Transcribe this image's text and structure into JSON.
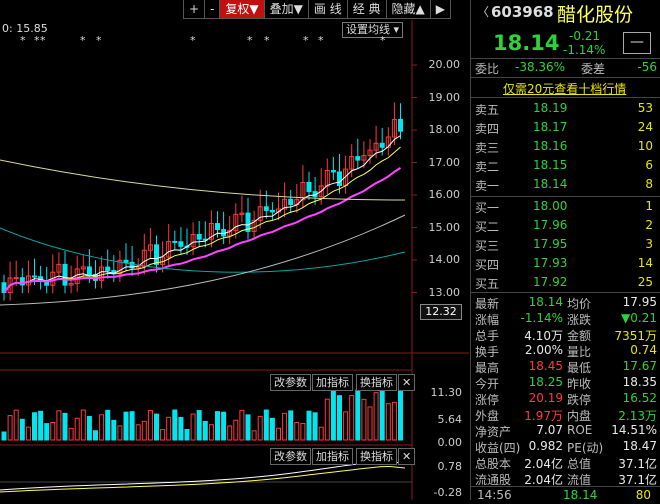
{
  "toolbar": {
    "plus": "+",
    "minus": "-",
    "fuquan": "复权▼",
    "diejia": "叠加▼",
    "huaxian": "画 线",
    "jingdian": "经 典",
    "yincang": "隐藏▲",
    "scroll": "▶"
  },
  "chart": {
    "info_text": "0: 15.85",
    "set_ma": "设置均线",
    "price_ticks": [
      "20.00",
      "19.00",
      "18.00",
      "17.00",
      "16.00",
      "15.00",
      "14.00",
      "13.00"
    ],
    "current_label": "12.32",
    "vol_ticks": [
      "11.30",
      "5.64",
      "0.00"
    ],
    "macd_ticks": [
      "0.78",
      "-0.28"
    ],
    "vol_buttons": [
      "改参数",
      "加指标",
      "换指标"
    ],
    "macd_buttons": [
      "改参数",
      "加指标",
      "换指标"
    ],
    "close": "✕"
  },
  "quote": {
    "code": "603968",
    "name": "醋化股份",
    "price": "18.14",
    "change": "-0.21",
    "change_pct": "-1.14%",
    "weibi_label": "委比",
    "weibi": "-38.36%",
    "weicha_label": "委差",
    "weicha": "-56",
    "promo": "仅需20元查看十档行情",
    "sells": [
      {
        "label": "卖五",
        "price": "18.19",
        "vol": "53"
      },
      {
        "label": "卖四",
        "price": "18.17",
        "vol": "24"
      },
      {
        "label": "卖三",
        "price": "18.16",
        "vol": "10"
      },
      {
        "label": "卖二",
        "price": "18.15",
        "vol": "6"
      },
      {
        "label": "卖一",
        "price": "18.14",
        "vol": "8"
      }
    ],
    "buys": [
      {
        "label": "买一",
        "price": "18.00",
        "vol": "1"
      },
      {
        "label": "买二",
        "price": "17.96",
        "vol": "2"
      },
      {
        "label": "买三",
        "price": "17.95",
        "vol": "3"
      },
      {
        "label": "买四",
        "price": "17.93",
        "vol": "14"
      },
      {
        "label": "买五",
        "price": "17.92",
        "vol": "25"
      }
    ],
    "stats": [
      {
        "l1": "最新",
        "v1": "18.14",
        "c1": "green",
        "l2": "均价",
        "v2": "17.95",
        "c2": "white"
      },
      {
        "l1": "涨幅",
        "v1": "-1.14%",
        "c1": "green",
        "l2": "涨跌",
        "v2": "▼0.21",
        "c2": "green"
      },
      {
        "l1": "总手",
        "v1": "4.10万",
        "c1": "white",
        "l2": "金额",
        "v2": "7351万",
        "c2": "yellow"
      },
      {
        "l1": "换手",
        "v1": "2.00%",
        "c1": "white",
        "l2": "量比",
        "v2": "0.74",
        "c2": "yellow"
      },
      {
        "l1": "最高",
        "v1": "18.45",
        "c1": "red",
        "l2": "最低",
        "v2": "17.67",
        "c2": "green"
      },
      {
        "l1": "今开",
        "v1": "18.25",
        "c1": "green",
        "l2": "昨收",
        "v2": "18.35",
        "c2": "white"
      },
      {
        "l1": "涨停",
        "v1": "20.19",
        "c1": "red",
        "l2": "跌停",
        "v2": "16.52",
        "c2": "green"
      },
      {
        "l1": "外盘",
        "v1": "1.97万",
        "c1": "red",
        "l2": "内盘",
        "v2": "2.13万",
        "c2": "green"
      },
      {
        "l1": "净资产",
        "v1": "7.07",
        "c1": "white",
        "l2": "ROE",
        "v2": "14.51%",
        "c2": "white"
      },
      {
        "l1": "收益(四)",
        "v1": "0.982",
        "c1": "white",
        "l2": "PE(动)",
        "v2": "18.47",
        "c2": "white"
      },
      {
        "l1": "总股本",
        "v1": "2.04亿",
        "c1": "white",
        "l2": "总值",
        "v2": "37.1亿",
        "c2": "white"
      },
      {
        "l1": "流通股",
        "v1": "2.04亿",
        "c1": "white",
        "l2": "流值",
        "v2": "37.1亿",
        "c2": "white"
      }
    ],
    "tick_time": "14:56",
    "tick_price": "18.14",
    "tick_vol": "80"
  },
  "colors": {
    "up": "#ff3a3a",
    "down": "#00e5ee",
    "ma5": "#ffffff",
    "ma10": "#ffff55",
    "ma20": "#ff44ff",
    "ma60": "#00aaaa"
  }
}
